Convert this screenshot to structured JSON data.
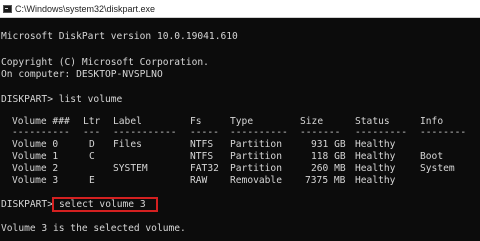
{
  "window": {
    "title": "C:\\Windows\\system32\\diskpart.exe"
  },
  "console": {
    "version_line": "Microsoft DiskPart version 10.0.19041.610",
    "copyright_line": "Copyright (C) Microsoft Corporation.",
    "computer_line": "On computer: DESKTOP-NVSPLNO",
    "prompt1": "DISKPART> list volume",
    "table": {
      "headers": [
        "Volume ###",
        "Ltr",
        "Label",
        "Fs",
        "Type",
        "Size",
        "Status",
        "Info"
      ],
      "separators": [
        "----------",
        "---",
        "-----------",
        "-----",
        "----------",
        "-------",
        "---------",
        "--------"
      ],
      "rows": [
        [
          "Volume 0",
          "D",
          "Files",
          "NTFS",
          "Partition",
          "931 GB",
          "Healthy",
          ""
        ],
        [
          "Volume 1",
          "C",
          "",
          "NTFS",
          "Partition",
          "118 GB",
          "Healthy",
          "Boot"
        ],
        [
          "Volume 2",
          "",
          "SYSTEM",
          "FAT32",
          "Partition",
          "260 MB",
          "Healthy",
          "System"
        ],
        [
          "Volume 3",
          "E",
          "",
          "RAW",
          "Removable",
          "7375 MB",
          "Healthy",
          ""
        ]
      ]
    },
    "prompt2_label": "DISKPART>",
    "prompt2_command": "select volume 3",
    "result_line": "Volume 3 is the selected volume."
  },
  "colors": {
    "background": "#0c0c0c",
    "text": "#d6d6d6",
    "highlight_border": "#d42020"
  }
}
